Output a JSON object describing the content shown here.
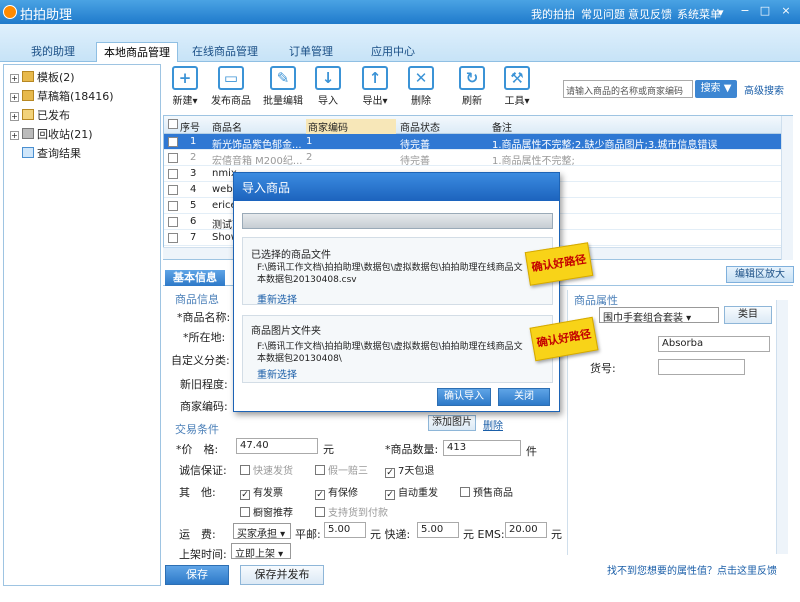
{
  "titlebar": {
    "title": "拍拍助理",
    "menu": [
      "我的拍拍",
      "常见问题",
      "意见反馈",
      "系统菜单"
    ],
    "win_buttons": [
      "−",
      "□",
      "×"
    ]
  },
  "tabs": [
    "我的助理",
    "本地商品管理",
    "在线商品管理",
    "订单管理",
    "应用中心"
  ],
  "tree": [
    {
      "label": "模板(2)",
      "expand": "+"
    },
    {
      "label": "草稿箱(18416)",
      "expand": "+"
    },
    {
      "label": "已发布",
      "expand": "+"
    },
    {
      "label": "回收站(21)",
      "expand": "+"
    },
    {
      "label": "查询结果",
      "expand": ""
    }
  ],
  "toolbar": [
    "新建",
    "发布商品",
    "批量编辑",
    "导入",
    "导出",
    "删除",
    "刷新",
    "工具"
  ],
  "search": {
    "placeholder": "请输入商品的名称或商家编码",
    "button": "搜索",
    "advanced": "高级搜索"
  },
  "grid": {
    "headers": [
      "序号",
      "商品名",
      "商家编码",
      "商品状态",
      "备注"
    ],
    "rows": [
      {
        "no": "1",
        "name": "新光饰品紫色郁金...",
        "code": "1",
        "status": "待完善",
        "note": "1.商品属性不完整;2.缺少商品图片;3.城市信息错误",
        "style": "sel"
      },
      {
        "no": "2",
        "name": "宏僖音箱 M200纪...",
        "code": "2",
        "status": "待完善",
        "note": "1.商品属性不完整;",
        "style": "dim"
      },
      {
        "no": "3",
        "name": "nmix...",
        "code": "",
        "status": "",
        "note": "",
        "style": ""
      },
      {
        "no": "4",
        "name": "web...",
        "code": "",
        "status": "",
        "note": "",
        "style": ""
      },
      {
        "no": "5",
        "name": "erice...",
        "code": "",
        "status": "",
        "note": "",
        "style": ""
      },
      {
        "no": "6",
        "name": "测试商...",
        "code": "",
        "status": "",
        "note": "",
        "style": ""
      },
      {
        "no": "7",
        "name": "Show...",
        "code": "",
        "status": "",
        "note": "",
        "style": ""
      }
    ]
  },
  "form": {
    "tab_basic": "基本信息",
    "edit_expand": "编辑区放大",
    "section_info": "商品信息",
    "name_label": "*商品名称:",
    "location_label": "*所在地:",
    "custom_category": "自定义分类:",
    "newness": "新旧程度:",
    "merchant_code": "商家编码:",
    "add_image": "添加图片",
    "delete": "删除",
    "section_trade": "交易条件",
    "price_label": "*价　格:",
    "price_value": "47.40",
    "price_unit": "元",
    "qty_label": "*商品数量:",
    "qty_value": "413",
    "qty_unit": "件",
    "guarantee_label": "诚信保证:",
    "guarantee_options": [
      {
        "label": "快速发货",
        "checked": false,
        "disabled": true
      },
      {
        "label": "假一赔三",
        "checked": false,
        "disabled": true
      },
      {
        "label": "7天包退",
        "checked": true,
        "disabled": false
      }
    ],
    "other_label": "其　他:",
    "other_options": [
      {
        "label": "有发票",
        "checked": true,
        "disabled": false
      },
      {
        "label": "有保修",
        "checked": true,
        "disabled": false
      },
      {
        "label": "自动重发",
        "checked": true,
        "disabled": false
      },
      {
        "label": "预售商品",
        "checked": false,
        "disabled": false
      }
    ],
    "other_options2": [
      {
        "label": "橱窗推荐",
        "checked": false,
        "disabled": false
      },
      {
        "label": "支持货到付款",
        "checked": false,
        "disabled": true
      }
    ],
    "shipping_label": "运　费:",
    "shipping_select": "买家承担",
    "ship_ping": "平邮:",
    "ship_ping_value": "5.00",
    "ship_express": "元 快递:",
    "ship_express_value": "5.00",
    "ship_ems": "元 EMS:",
    "ship_ems_value": "20.00",
    "ship_unit": "元",
    "list_time_label": "上架时间:",
    "list_time_select": "立即上架",
    "save_btn": "保存(Ctrl+S)",
    "save_publish_btn": "保存并发布"
  },
  "props": {
    "title": "商品属性",
    "category_select": "围巾手套组合套装",
    "category_btn": "类目",
    "brand_value": "Absorba",
    "article_label": "货号:",
    "help_link": "找不到您想要的属性值？点击这里反馈"
  },
  "dialog": {
    "title": "导入商品",
    "file_label": "已选择的商品文件",
    "file_path": "F:\\腾讯工作文档\\拍拍助理\\数据包\\虚拟数据包\\拍拍助理在线商品文本数据包20130408.csv",
    "reselect1": "重新选择",
    "image_label": "商品图片文件夹",
    "image_path": "F:\\腾讯工作文档\\拍拍助理\\数据包\\虚拟数据包\\拍拍助理在线商品文本数据包20130408\\",
    "reselect2": "重新选择",
    "confirm_btn": "确认导入",
    "close_btn": "关闭",
    "sticker1": "确认好路径",
    "sticker2": "确认好路径"
  }
}
